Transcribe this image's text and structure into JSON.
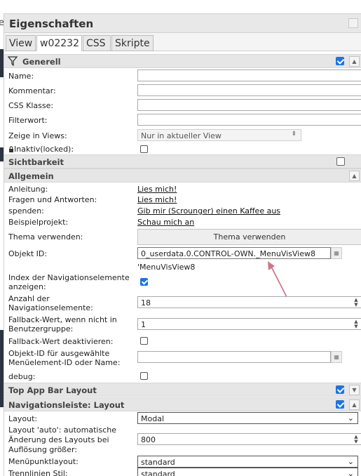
{
  "left_edge": {
    "glyph": "e"
  },
  "panel": {
    "title": "Eigenschaften",
    "tabs": [
      {
        "label": "View",
        "active": false
      },
      {
        "label": "w02232",
        "active": true
      },
      {
        "label": "CSS",
        "active": false
      },
      {
        "label": "Skripte",
        "active": false
      }
    ]
  },
  "generell": {
    "title": "Generell",
    "checked": true,
    "fields": {
      "name_label": "Name:",
      "kommentar_label": "Kommentar:",
      "css_klasse_label": "CSS Klasse:",
      "filterwort_label": "Filterwort:",
      "zeige_label": "Zeige in Views:",
      "zeige_value": "Nur in aktueller View",
      "inaktiv_label": "Inaktiv(locked):"
    }
  },
  "sichtbarkeit": {
    "title": "Sichtbarkeit",
    "checked": false
  },
  "allgemein": {
    "title": "Allgemein",
    "anleitung_label": "Anleitung:",
    "anleitung_link": "Lies mich!",
    "fragen_label": "Fragen und Antworten:",
    "fragen_link": "Lies mich!",
    "spenden_label": "spenden:",
    "spenden_link": "Gib mir (Scrounger) einen Kaffee aus",
    "beispiel_label": "Beispielprojekt:",
    "beispiel_link": "Schau mich an",
    "thema_label": "Thema verwenden:",
    "thema_button": "Thema verwenden",
    "objekt_label": "Objekt ID:",
    "objekt_value": "0_userdata.0.CONTROL-OWN._MenuVisView8",
    "objekt_hint": "'MenuVisView8",
    "index_label": "Index der Navigationselemente anzeigen:",
    "index_checked": true,
    "anzahl_label": "Anzahl der Navigationselemente:",
    "anzahl_value": "18",
    "fallback_label": "Fallback-Wert, wenn nicht in Benutzergruppe:",
    "fallback_value": "1",
    "fallback_deakt_label": "Fallback-Wert deaktivieren:",
    "fallback_deakt_checked": false,
    "objekt_ausgewaehlt_label": "Objekt-ID für ausgewählte Menüelement-ID oder Name:",
    "objekt_ausgewaehlt_value": "",
    "debug_label": "debug:",
    "debug_checked": false
  },
  "top_app_bar": {
    "title": "Top App Bar Layout",
    "checked": true
  },
  "nav_layout": {
    "title": "Navigationsleiste: Layout",
    "checked": true,
    "layout_label": "Layout:",
    "layout_value": "Modal",
    "auto_label": "Layout 'auto': automatische Änderung des Layouts bei Auflösung größer:",
    "auto_value": "800",
    "menuepunkt_label": "Menüpunktlayout:",
    "menuepunkt_value": "standard",
    "trennlinien_label": "Trennlinien Stil:",
    "trennlinien_value": "standard"
  },
  "colors": {
    "accent": "#1a73e8",
    "arrow": "#c97a8a",
    "section_bg": "#e6e6e6"
  },
  "icons": {
    "filter": "filter-icon",
    "lock": "lock-icon",
    "arrow": "annotation-arrow-icon"
  }
}
